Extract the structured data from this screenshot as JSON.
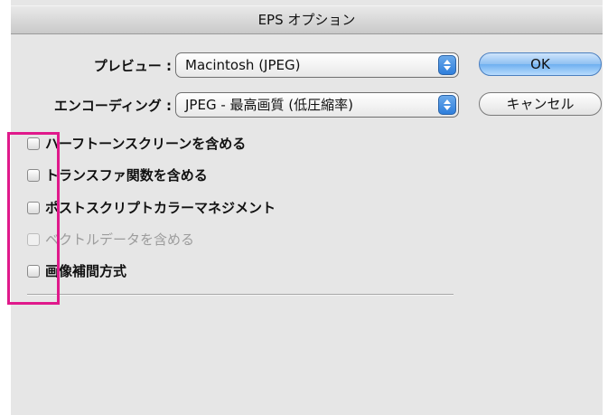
{
  "dialog": {
    "title": "EPS オプション",
    "preview_label": "プレビュー :",
    "preview_value": "Macintosh (JPEG)",
    "encoding_label": "エンコーディング :",
    "encoding_value": "JPEG - 最高画質 (低圧縮率)",
    "ok_label": "OK",
    "cancel_label": "キャンセル",
    "checkboxes": [
      {
        "label": "ハーフトーンスクリーンを含める",
        "checked": false,
        "enabled": true
      },
      {
        "label": "トランスファ関数を含める",
        "checked": false,
        "enabled": true
      },
      {
        "label": "ポストスクリプトカラーマネジメント",
        "checked": false,
        "enabled": true
      },
      {
        "label": "ベクトルデータを含める",
        "checked": false,
        "enabled": false
      },
      {
        "label": "画像補間方式",
        "checked": false,
        "enabled": true
      }
    ]
  },
  "annotation": {
    "color": "#e0198b"
  }
}
